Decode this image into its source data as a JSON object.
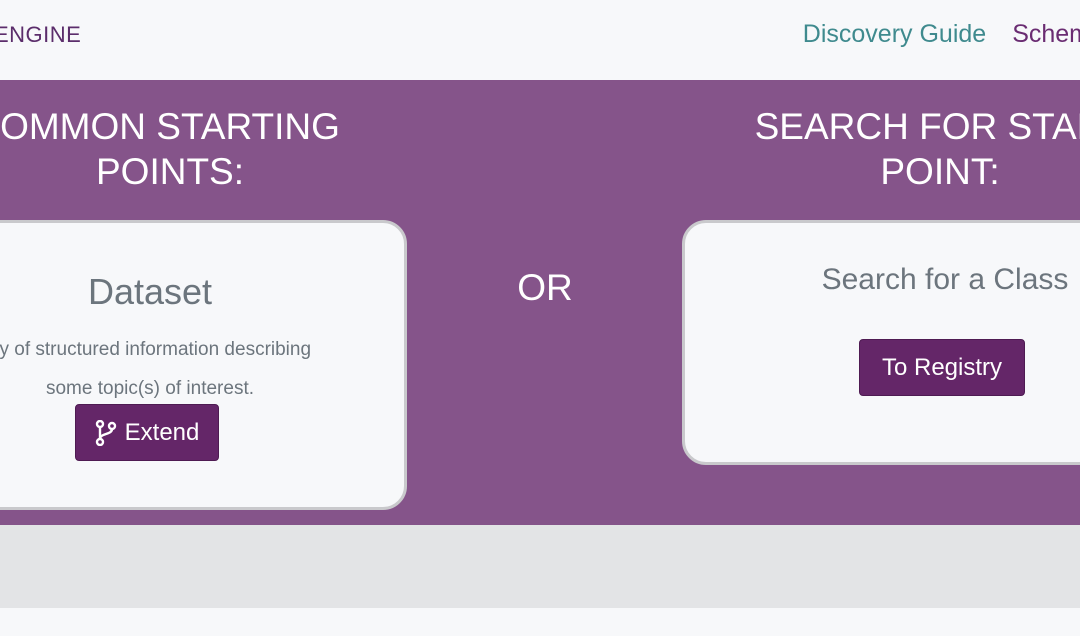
{
  "navbar": {
    "brand": "ENGINE",
    "links": [
      {
        "label": "Discovery Guide"
      },
      {
        "label": "Schem"
      }
    ]
  },
  "hero": {
    "left_heading_line1": "OMMON STARTING",
    "left_heading_line2": "POINTS:",
    "right_heading_line1": "SEARCH FOR START",
    "right_heading_line2": "POINT:",
    "or_label": "OR"
  },
  "dataset_card": {
    "title": "Dataset",
    "desc_line1": "dy of structured information describing",
    "desc_line2": "some topic(s) of interest.",
    "button_label": "Extend",
    "button_icon": "branch-icon"
  },
  "search_card": {
    "title": "Search for a Class",
    "button_label": "To Registry"
  },
  "colors": {
    "hero_bg": "#85548a",
    "button_bg": "#642668",
    "guide_link": "#3f8a8e",
    "schema_link": "#6a2c72",
    "muted_text": "#6c757d",
    "footer_band": "#e3e4e6"
  }
}
